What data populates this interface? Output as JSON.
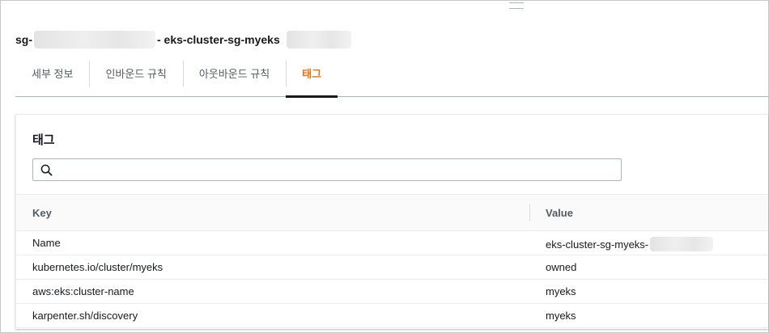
{
  "header": {
    "title_prefix": "sg-",
    "title_suffix": "- eks-cluster-sg-myeks"
  },
  "tabs": [
    {
      "label": "세부 정보",
      "active": false
    },
    {
      "label": "인바운드 규칙",
      "active": false
    },
    {
      "label": "아웃바운드 규칙",
      "active": false
    },
    {
      "label": "태그",
      "active": true
    }
  ],
  "panel": {
    "title": "태그",
    "search": {
      "value": "",
      "placeholder": ""
    }
  },
  "table": {
    "columns": [
      "Key",
      "Value"
    ],
    "rows": [
      {
        "key": "Name",
        "value": "eks-cluster-sg-myeks-"
      },
      {
        "key": "kubernetes.io/cluster/myeks",
        "value": "owned"
      },
      {
        "key": "aws:eks:cluster-name",
        "value": "myeks"
      },
      {
        "key": "karpenter.sh/discovery",
        "value": "myeks"
      }
    ]
  },
  "colors": {
    "active_tab": "#ec7211",
    "text": "#16191f",
    "muted": "#545b64"
  },
  "icons": {
    "search": "search-icon",
    "handle": "drag-handle-icon"
  }
}
